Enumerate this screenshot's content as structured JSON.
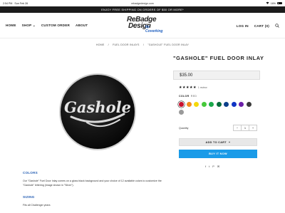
{
  "status_bar": {
    "time": "2:54 PM",
    "date": "Sun Feb 28",
    "url": "rebadgedesign.com",
    "battery": "16%"
  },
  "promo": "ENJOY FREE SHIPPING ON ORDERS OF $50 OR MORE*",
  "nav": {
    "home": "HOME",
    "shop": "SHOP",
    "shop_chevron": "⌄",
    "custom_order": "CUSTOM ORDER",
    "about": "ABOUT",
    "login": "LOG IN",
    "cart": "CART (0)",
    "search_icon": "search-icon"
  },
  "logo": {
    "line1": "ReBadge",
    "line2": "Design",
    "line3": "by Coverking"
  },
  "breadcrumb": [
    "HOME",
    "/",
    "FUEL DOOR INLAYS",
    "/",
    "\"GASHOLE\" FUEL DOOR INLAY"
  ],
  "product": {
    "title": "\"GASHOLE\" FUEL DOOR INLAY",
    "price": "$35.00",
    "image_text": "Gashole",
    "review_count": "1 review",
    "color_label": "COLOR",
    "color_value": "RED",
    "swatches": [
      "#c8102e",
      "#f28c1c",
      "#f5d90a",
      "#46c93a",
      "#1aa84b",
      "#0a6b3b",
      "#0c3f8a",
      "#1034c4",
      "#6b1fa8",
      "#3b3b3b",
      "#9a9a9a"
    ],
    "selected_swatch": 0,
    "quantity_label": "Quantity",
    "qty_minus": "−",
    "quantity": "1",
    "qty_plus": "+",
    "add_to_cart": "ADD TO CART",
    "add_to_cart_icon": "+",
    "buy_now": "BUY IT NOW",
    "share": {
      "facebook": "f",
      "twitter": "t",
      "pinterest": "P",
      "email": "✉"
    }
  },
  "description": {
    "colors_heading": "COLORS",
    "colors_text": "Our \"Gashole\" Fuel Door Inlay comes on a gloss black background and your choice of 12 available colors to customize the \"Gashole\" lettering (image shown in \"Silver\").",
    "sizing_heading": "SIZING",
    "sizing_text": "Fits all Challenger years"
  }
}
